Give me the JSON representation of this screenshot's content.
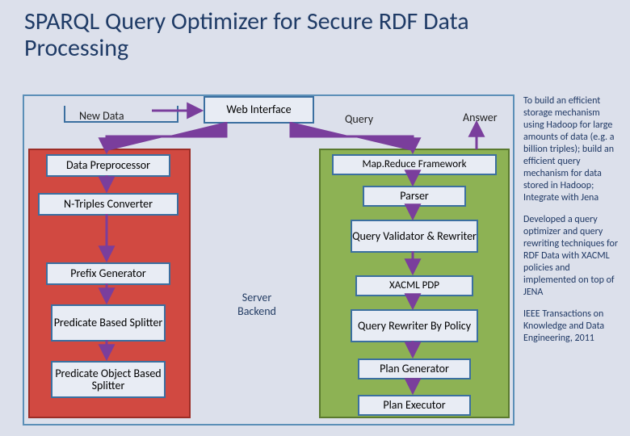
{
  "title": "SPARQL Query Optimizer for Secure RDF Data Processing",
  "labels": {
    "new_data": "New Data",
    "query": "Query",
    "answer": "Answer"
  },
  "boxes": {
    "web_interface": "Web Interface",
    "data_preprocessor": "Data Preprocessor",
    "n_triples_converter": "N-Triples Converter",
    "prefix_generator": "Prefix Generator",
    "predicate_based_splitter": "Predicate Based Splitter",
    "predicate_object_based_splitter": "Predicate Object Based Splitter",
    "server_backend": "Server Backend",
    "mapreduce_framework": "Map.Reduce Framework",
    "parser": "Parser",
    "query_validator_rewriter": "Query Validator & Rewriter",
    "xacml_pdp": "XACML PDP",
    "query_rewriter_by_policy": "Query Rewriter By Policy",
    "plan_generator": "Plan Generator",
    "plan_executor": "Plan Executor"
  },
  "right_text": {
    "p1": "To build an efficient storage mechanism using Hadoop for large amounts of data (e.g. a billion triples); build an efficient query mechanism for data stored in Hadoop; Integrate with Jena",
    "p2": "Developed a query optimizer and query rewriting techniques for RDF Data with XACML policies and implemented on top of JENA",
    "p3": "IEEE Transactions on Knowledge and Data Engineering, 2011"
  }
}
